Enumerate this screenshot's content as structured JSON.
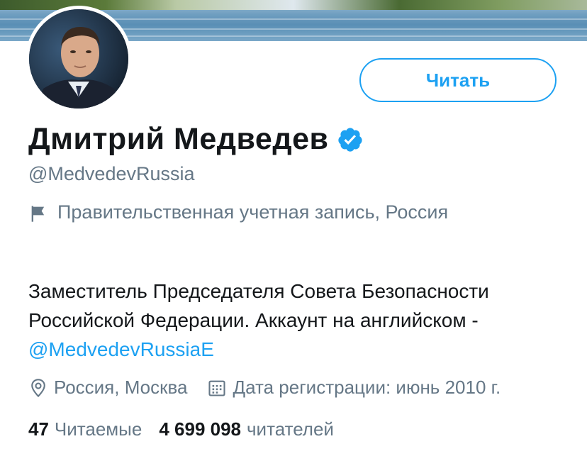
{
  "profile": {
    "name": "Дмитрий Медведев",
    "handle": "@MedvedevRussia",
    "label": "Правительственная учетная запись, Россия",
    "bio_text": "Заместитель Председателя Совета Безопасности Российской Федерации. Аккаунт на английском - ",
    "bio_link": "@MedvedevRussiaE",
    "location": "Россия, Москва",
    "joined": "Дата регистрации: июнь 2010 г.",
    "following_count": "47",
    "following_label": "Читаемые",
    "followers_count": "4 699 098",
    "followers_label": "читателей"
  },
  "actions": {
    "follow_label": "Читать"
  },
  "icons": {
    "verified": "verified-badge-icon",
    "label": "flag-icon",
    "location": "location-pin-icon",
    "calendar": "calendar-icon"
  },
  "colors": {
    "accent": "#1da1f2",
    "text_primary": "#14171a",
    "text_secondary": "#657786"
  }
}
